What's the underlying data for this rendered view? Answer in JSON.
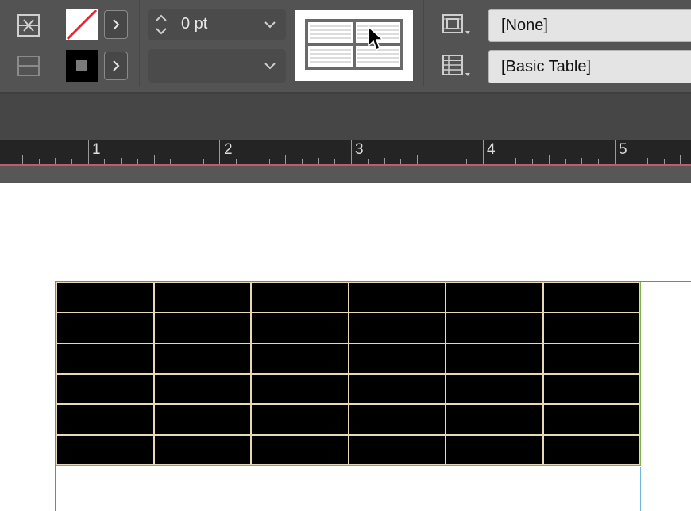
{
  "toolbar": {
    "stroke_weight": {
      "value": "0 pt"
    },
    "stroke_type": {
      "value": ""
    },
    "cell_style": {
      "selected": "[None]"
    },
    "table_style": {
      "selected": "[Basic Table]"
    },
    "icons": {
      "merge_cells": "merge-cells-icon",
      "split_cells": "split-cells-icon",
      "fill": "fill-none-swatch-icon",
      "stroke": "stroke-swatch-icon",
      "cell_styles": "cell-styles-icon",
      "table_styles": "table-styles-icon"
    }
  },
  "ruler": {
    "labels": [
      "1",
      "2",
      "3",
      "4",
      "5"
    ]
  },
  "table": {
    "rows": 6,
    "columns": 6,
    "cell_fill": "#000000",
    "stroke_color": "#e8d7b8"
  },
  "colors": {
    "toolbar_bg": "#535353",
    "subbar_bg": "#464646",
    "ruler_bg": "#242424",
    "margin_guide": "#d946c9",
    "bleed_guide": "#6fb7d9"
  }
}
